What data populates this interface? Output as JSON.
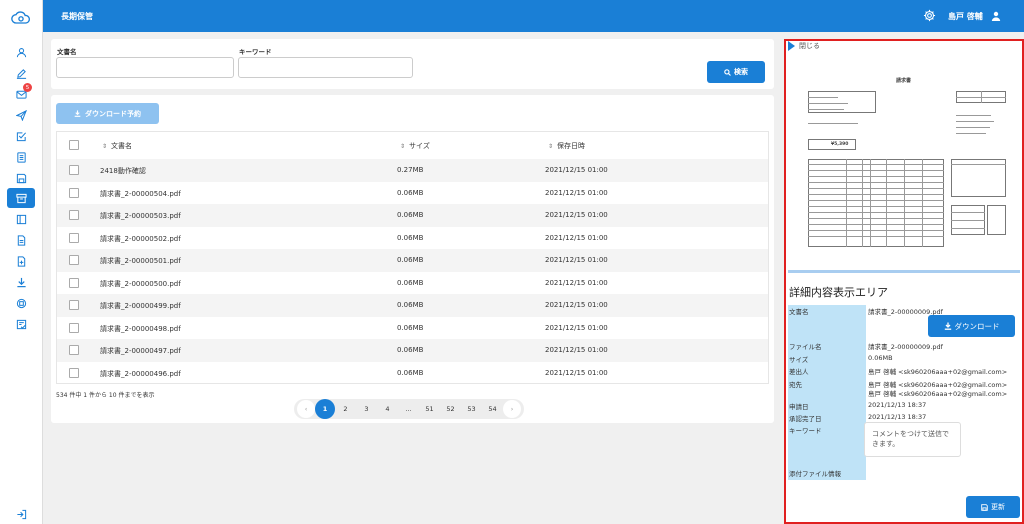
{
  "header": {
    "title": "長期保管",
    "user_name": "島戸 啓輔"
  },
  "sidebar": {
    "badge_count": "5",
    "icons": [
      "user-icon",
      "pencil-icon",
      "mail-icon",
      "send-icon",
      "check-square-icon",
      "list-icon",
      "save-icon",
      "archive-icon",
      "layout-icon",
      "file-icon",
      "file-plus-icon",
      "download-icon",
      "stamp-icon",
      "document-check-icon"
    ]
  },
  "search": {
    "doc_label": "文書名",
    "keyword_label": "キーワード",
    "doc_value": "",
    "keyword_value": "",
    "button_label": "検索"
  },
  "table": {
    "download_button": "ダウンロード予約",
    "columns": {
      "name": "文書名",
      "size": "サイズ",
      "date": "保存日時"
    },
    "rows": [
      {
        "name": "2418動作確認",
        "size": "0.27MB",
        "date": "2021/12/15 01:00"
      },
      {
        "name": "請求書_2-00000504.pdf",
        "size": "0.06MB",
        "date": "2021/12/15 01:00"
      },
      {
        "name": "請求書_2-00000503.pdf",
        "size": "0.06MB",
        "date": "2021/12/15 01:00"
      },
      {
        "name": "請求書_2-00000502.pdf",
        "size": "0.06MB",
        "date": "2021/12/15 01:00"
      },
      {
        "name": "請求書_2-00000501.pdf",
        "size": "0.06MB",
        "date": "2021/12/15 01:00"
      },
      {
        "name": "請求書_2-00000500.pdf",
        "size": "0.06MB",
        "date": "2021/12/15 01:00"
      },
      {
        "name": "請求書_2-00000499.pdf",
        "size": "0.06MB",
        "date": "2021/12/15 01:00"
      },
      {
        "name": "請求書_2-00000498.pdf",
        "size": "0.06MB",
        "date": "2021/12/15 01:00"
      },
      {
        "name": "請求書_2-00000497.pdf",
        "size": "0.06MB",
        "date": "2021/12/15 01:00"
      },
      {
        "name": "請求書_2-00000496.pdf",
        "size": "0.06MB",
        "date": "2021/12/15 01:00"
      }
    ],
    "count_text": "534 件中 1 件から 10 件までを表示",
    "pages": [
      "1",
      "2",
      "3",
      "4",
      "...",
      "51",
      "52",
      "53",
      "54"
    ],
    "prev": "‹",
    "next": "›"
  },
  "panel": {
    "close_label": "閉じる",
    "preview": {
      "title": "請求書",
      "total": "¥5,390"
    },
    "detail_title": "詳細内容表示エリア",
    "labels": {
      "doc_name": "文書名",
      "file_name": "ファイル名",
      "size": "サイズ",
      "sender": "差出人",
      "recipient": "宛先",
      "apply_date": "申請日",
      "approve_date": "承認完了日",
      "keyword": "キーワード",
      "attachment": "添付ファイル情報"
    },
    "values": {
      "doc_name": "請求書_2-00000009.pdf",
      "file_name": "請求書_2-00000009.pdf",
      "size": "0.06MB",
      "sender": "島戸 啓輔 <sk960206aaa+02@gmail.com>",
      "recipient_1": "島戸 啓輔 <sk960206aaa+02@gmail.com>",
      "recipient_2": "島戸 啓輔 <sk960206aaa+02@gmail.com>",
      "apply_date": "2021/12/13 18:37",
      "approve_date": "2021/12/13 18:37"
    },
    "download_button": "ダウンロード",
    "comment_placeholder": "コメントをつけて送信できます。",
    "update_button": "更新"
  },
  "colors": {
    "primary": "#1a7fd6",
    "highlight_border": "#e02020",
    "label_bg": "#bfe3f7"
  }
}
